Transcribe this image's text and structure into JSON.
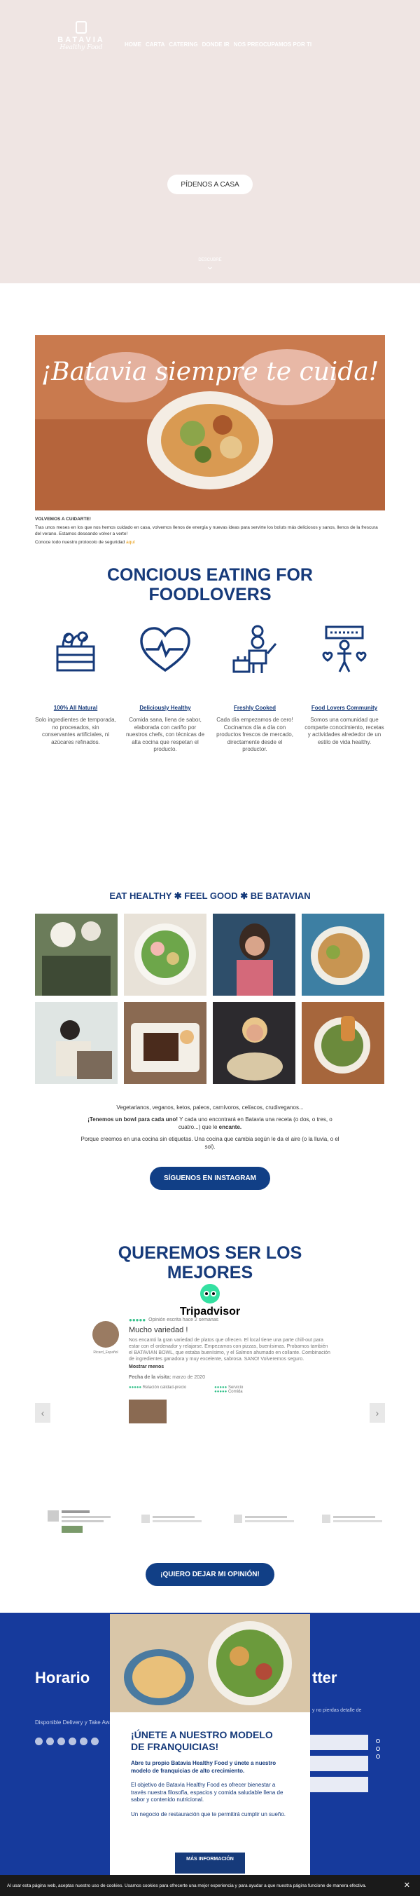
{
  "brand": {
    "name": "BATAVIA",
    "tagline": "Healthy Food"
  },
  "nav": [
    "HOME",
    "CARTA",
    "CATERING",
    "DONDE IR",
    "NOS PREOCUPAMOS POR TI"
  ],
  "hero": {
    "cta": "PÍDENOS A CASA",
    "scroll_label": "DESCUBRE"
  },
  "banner_title": "¡Batavia siempre te cuida!",
  "intro": {
    "heading": "VOLVEMOS A CUIDARTE!",
    "line1": "Tras unos meses en los que nos hemos cuidado en casa, volvemos llenos de energía y nuevas ideas para servirte los boluts más deliciosos y sanos, llenos de la frescura del verano. Estamos deseando volver a verte!",
    "line2_pre": "Conoce todo nuestro protocolo de seguridad ",
    "line2_link": "aquí"
  },
  "conscious_title": "CONCIOUS EATING FOR FOODLOVERS",
  "features": [
    {
      "label": "100% All Natural",
      "text": "Solo ingredientes de temporada, no procesados, sin conservantes artificiales, ni azúcares refinados."
    },
    {
      "label": "Deliciously Healthy",
      "text": "Comida sana, llena de sabor, elaborada con cariño por nuestros chefs, con técnicas de alta cocina que respetan el producto."
    },
    {
      "label": "Freshly Cooked",
      "text": "Cada día empezamos de cero! Cocinamos día a día con productos frescos de mercado, directamente desde el productor."
    },
    {
      "label": "Food Lovers Community",
      "text": "Somos una comunidad que comparte conocimiento, recetas y actividades alrededor de un estilo de vida healthy."
    }
  ],
  "eat_healthy": "EAT HEALTHY ✱ FEEL GOOD ✱ BE BATAVIAN",
  "desc": {
    "line1": "Vegetarianos, veganos, ketos, paleos, carnívoros, celíacos, crudiveganos...",
    "line2_bold": "¡Tenemos un bowl para cada uno!",
    "line2_rest": " Y cada uno encontrará en Batavia una receta (o dos, o tres, o cuatro...) que le ",
    "line2_end": "encante.",
    "line3": "Porque creemos en una cocina sin etiquetas. Una cocina que cambia según le da el aire (o la lluvia, o el sol)."
  },
  "instagram_button": "SÍGUENOS EN INSTAGRAM",
  "best_title": "QUEREMOS SER LOS MEJORES",
  "tripadvisor": "Tripadvisor",
  "review": {
    "meta": "Opinión escrita hace 2 semanas",
    "title": "Mucho variedad !",
    "body": "Nos encantó la gran variedad de platos que ofrecen. El local tiene una parte chill-out para estar con el ordenador y relajarse. Empezamos con pizzas, buenísimas. Probamos también el BATAVIAN BOWL, que estaba buenísimo, y el Salmon ahumado en collante. Combinación de ingredientes ganadora y muy excelente, sabrosa. SANO! Volveremos seguro.",
    "more": "Mostrar menos",
    "visit_label": "Fecha de la visita:",
    "visit_date": "marzo de 2020",
    "user": "Ricard_Español",
    "r1": "Relación calidad-precio",
    "r2": "Servicio",
    "r3": "Comida"
  },
  "opinion_button": "¡QUIERO DEJAR MI OPINIÓN!",
  "footer": {
    "left_title": "Horario",
    "left_text": "Disponible Delivery y Take Away",
    "right_title": "tter",
    "right_text": "y no pierdas detalle de"
  },
  "modal": {
    "title": "¡ÚNETE A NUESTRO MODELO DE FRANQUICIAS!",
    "p1": "Abre tu propio Batavia Healthy Food y únete a nuestro modelo de franquicias de alto crecimiento.",
    "p2": "El objetivo de Batavia Healthy Food es ofrecer bienestar a través nuestra filosofía, espacios y comida saludable llena de sabor y contenido nutricional.",
    "p3": "Un negocio de restauración que te permitirá cumplir un sueño.",
    "button": "MÁS INFORMACIÓN"
  },
  "cookie": "Al usar esta página web, aceptas nuestro uso de cookies. Usamos cookies para ofrecerte una mejor experiencia y para ayudar a que nuestra página funcione de manera efectiva.",
  "colors": {
    "navy": "#163a7a",
    "footer_blue": "#163a9c",
    "hero_bg": "#efe5e3",
    "trip_green": "#34e0a1"
  }
}
